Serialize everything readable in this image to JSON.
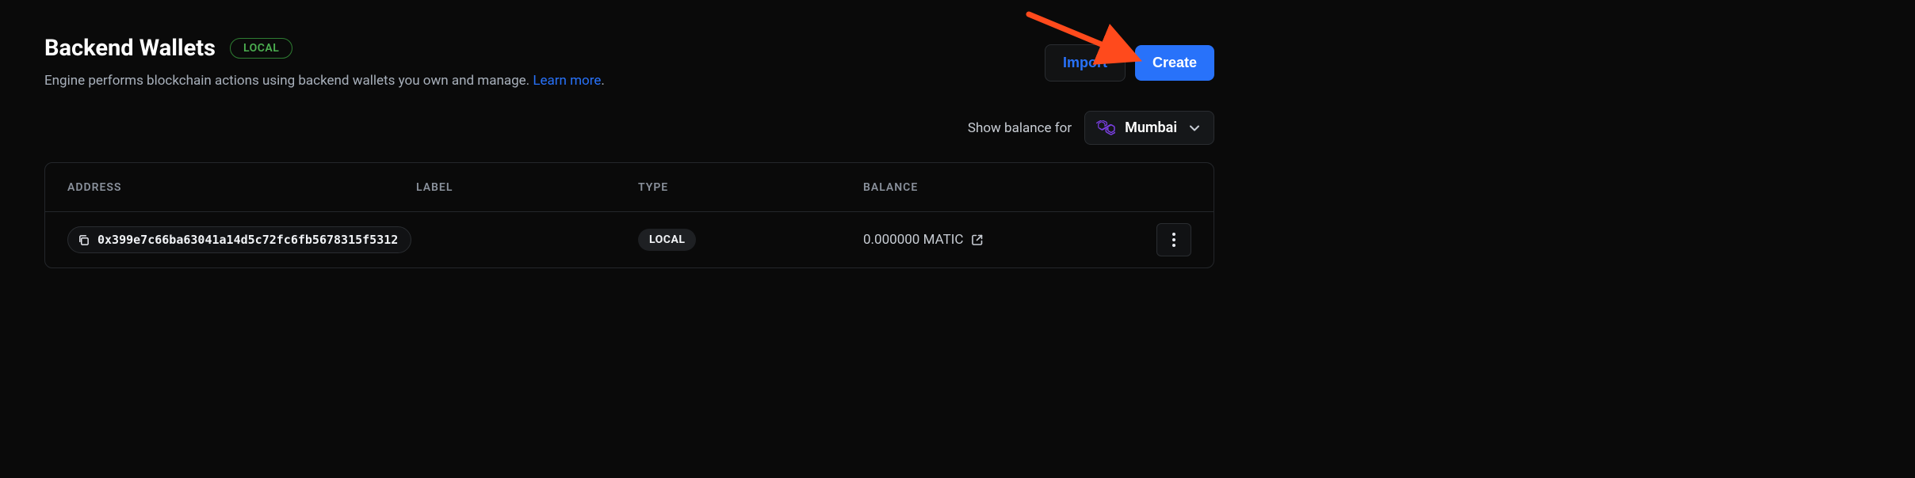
{
  "header": {
    "title": "Backend Wallets",
    "badge": "LOCAL",
    "subtitle_text": "Engine performs blockchain actions using backend wallets you own and manage. ",
    "learn_more": "Learn more",
    "period": "."
  },
  "actions": {
    "import_label": "Import",
    "create_label": "Create"
  },
  "balance": {
    "label": "Show balance for",
    "network": "Mumbai"
  },
  "table": {
    "columns": {
      "address": "ADDRESS",
      "label": "LABEL",
      "type": "TYPE",
      "balance": "BALANCE"
    },
    "rows": [
      {
        "address": "0x399e7c66ba63041a14d5c72fc6fb5678315f5312",
        "label": "",
        "type": "LOCAL",
        "balance": "0.000000 MATIC"
      }
    ]
  }
}
